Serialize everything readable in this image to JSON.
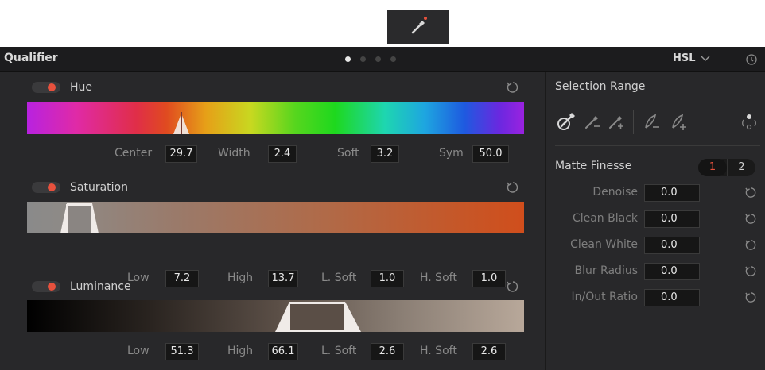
{
  "tool_tab": {
    "icon": "eyedropper-icon",
    "indicator_color": "#e7513d"
  },
  "header": {
    "title": "Qualifier",
    "mode": "HSL",
    "mode_icon": "chevron-down-icon",
    "reset_icon": "reset-all-icon",
    "pages": [
      {
        "active": true
      },
      {
        "active": false
      },
      {
        "active": false
      },
      {
        "active": false
      }
    ]
  },
  "hue": {
    "label": "Hue",
    "enabled": true,
    "params": [
      {
        "label": "Center",
        "value": "29.7"
      },
      {
        "label": "Width",
        "value": "2.4"
      },
      {
        "label": "Soft",
        "value": "3.2"
      },
      {
        "label": "Sym",
        "value": "50.0"
      }
    ]
  },
  "saturation": {
    "label": "Saturation",
    "enabled": true,
    "params": [
      {
        "label": "Low",
        "value": "7.2"
      },
      {
        "label": "High",
        "value": "13.7"
      },
      {
        "label": "L. Soft",
        "value": "1.0"
      },
      {
        "label": "H. Soft",
        "value": "1.0"
      }
    ]
  },
  "luminance": {
    "label": "Luminance",
    "enabled": true,
    "params": [
      {
        "label": "Low",
        "value": "51.3"
      },
      {
        "label": "High",
        "value": "66.1"
      },
      {
        "label": "L. Soft",
        "value": "2.6"
      },
      {
        "label": "H. Soft",
        "value": "2.6"
      }
    ]
  },
  "selection_range": {
    "title": "Selection Range",
    "tools": [
      "picker-icon",
      "picker-subtract-icon",
      "picker-add-icon",
      "feather-subtract-icon",
      "feather-add-icon",
      "invert-icon"
    ]
  },
  "matte_finesse": {
    "title": "Matte Finesse",
    "tabs": [
      "1",
      "2"
    ],
    "active_tab": "1",
    "rows": [
      {
        "label": "Denoise",
        "value": "0.0"
      },
      {
        "label": "Clean Black",
        "value": "0.0"
      },
      {
        "label": "Clean White",
        "value": "0.0"
      },
      {
        "label": "Blur Radius",
        "value": "0.0"
      },
      {
        "label": "In/Out Ratio",
        "value": "0.0"
      }
    ]
  },
  "colors": {
    "accent": "#e7513d",
    "panel": "#28282a",
    "header": "#1c1c1e"
  }
}
